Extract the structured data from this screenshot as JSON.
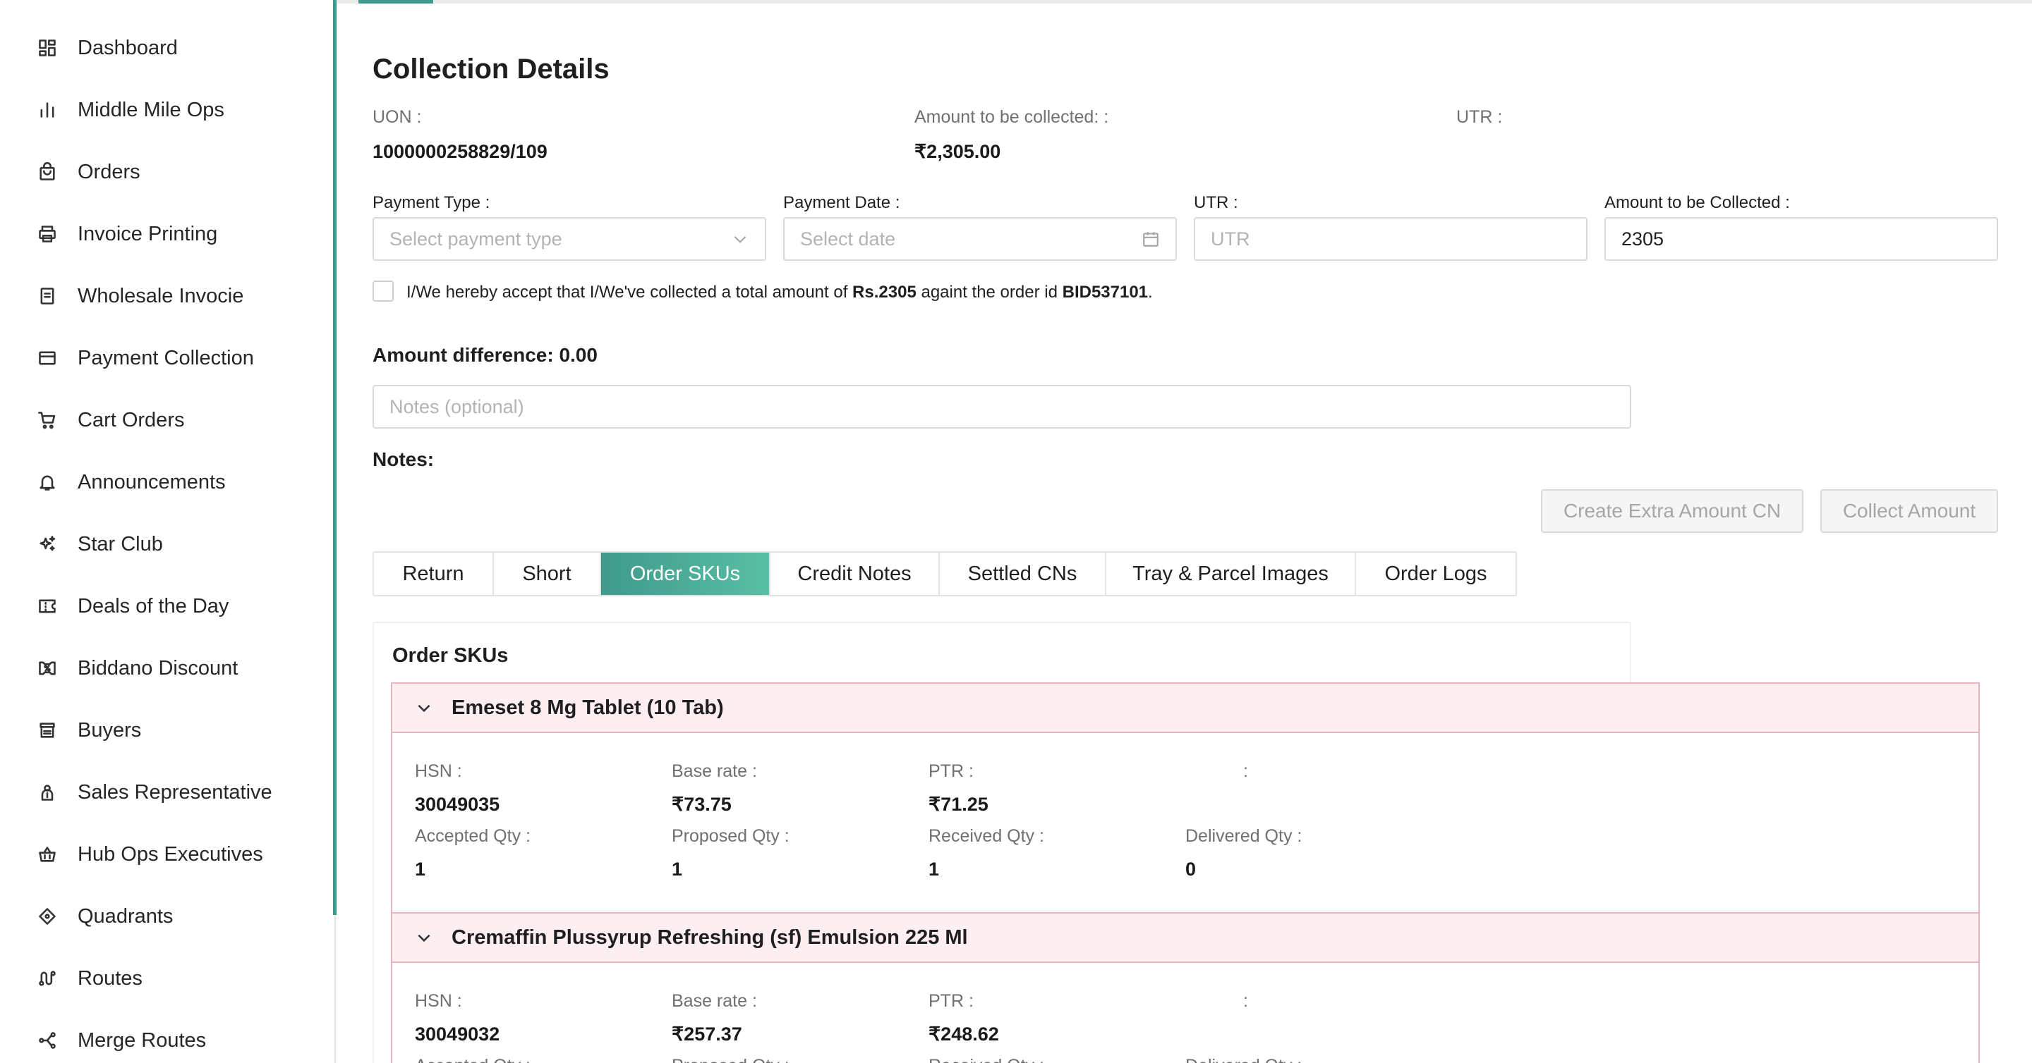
{
  "sidebar": {
    "items": [
      {
        "label": "Dashboard",
        "icon": "dashboard-icon"
      },
      {
        "label": "Middle Mile Ops",
        "icon": "bar-chart-icon"
      },
      {
        "label": "Orders",
        "icon": "shopping-bag-icon"
      },
      {
        "label": "Invoice Printing",
        "icon": "printer-icon"
      },
      {
        "label": "Wholesale Invocie",
        "icon": "document-icon"
      },
      {
        "label": "Payment Collection",
        "icon": "credit-card-icon"
      },
      {
        "label": "Cart Orders",
        "icon": "cart-icon"
      },
      {
        "label": "Announcements",
        "icon": "bell-icon"
      },
      {
        "label": "Star Club",
        "icon": "sparkle-icon"
      },
      {
        "label": "Deals of the Day",
        "icon": "coupon-icon"
      },
      {
        "label": "Biddano Discount",
        "icon": "discount-tag-icon"
      },
      {
        "label": "Buyers",
        "icon": "store-icon"
      },
      {
        "label": "Sales Representative",
        "icon": "user-badge-icon"
      },
      {
        "label": "Hub Ops Executives",
        "icon": "basket-icon"
      },
      {
        "label": "Quadrants",
        "icon": "diamond-icon"
      },
      {
        "label": "Routes",
        "icon": "route-icon"
      },
      {
        "label": "Merge Routes",
        "icon": "merge-icon"
      }
    ],
    "accent_color": "#3f9a8c"
  },
  "collection": {
    "title": "Collection Details",
    "uon_label": "UON :",
    "uon_value": "1000000258829/109",
    "amount_label": "Amount to be collected: :",
    "amount_value": "₹2,305.00",
    "utr_label": "UTR :",
    "utr_value": ""
  },
  "form": {
    "payment_type_label": "Payment Type :",
    "payment_type_placeholder": "Select payment type",
    "payment_date_label": "Payment Date :",
    "payment_date_placeholder": "Select date",
    "utr_label": "UTR :",
    "utr_placeholder": "UTR",
    "amount_label": "Amount to be Collected :",
    "amount_value": "2305",
    "consent_prefix": "I/We hereby accept that I/We've collected a total amount of ",
    "consent_amount": "Rs.2305",
    "consent_middle": " againt the order id ",
    "consent_order": "BID537101",
    "consent_suffix": ".",
    "consent_checked": false,
    "amount_difference": "Amount difference: 0.00",
    "notes_placeholder": "Notes (optional)",
    "notes_title": "Notes:"
  },
  "actions": {
    "create_cn": "Create Extra Amount CN",
    "collect": "Collect Amount"
  },
  "tabs": [
    {
      "label": "Return",
      "active": false
    },
    {
      "label": "Short",
      "active": false
    },
    {
      "label": "Order SKUs",
      "active": true
    },
    {
      "label": "Credit Notes",
      "active": false
    },
    {
      "label": "Settled CNs",
      "active": false
    },
    {
      "label": "Tray & Parcel Images",
      "active": false
    },
    {
      "label": "Order Logs",
      "active": false
    }
  ],
  "order_skus": {
    "title": "Order SKUs",
    "items": [
      {
        "name": "Emeset 8 Mg Tablet (10 Tab)",
        "hsn_label": "HSN :",
        "hsn": "30049035",
        "base_rate_label": "Base rate :",
        "base_rate": "₹73.75",
        "ptr_label": "PTR :",
        "ptr": "₹71.25",
        "blank_label": ":",
        "accepted_label": "Accepted Qty :",
        "accepted": "1",
        "proposed_label": "Proposed Qty :",
        "proposed": "1",
        "received_label": "Received Qty :",
        "received": "1",
        "delivered_label": "Delivered Qty :",
        "delivered": "0"
      },
      {
        "name": "Cremaffin Plussyrup Refreshing (sf) Emulsion 225 Ml",
        "hsn_label": "HSN :",
        "hsn": "30049032",
        "base_rate_label": "Base rate :",
        "base_rate": "₹257.37",
        "ptr_label": "PTR :",
        "ptr": "₹248.62",
        "blank_label": ":",
        "accepted_label": "Accepted Qty :",
        "proposed_label": "Proposed Qty :",
        "received_label": "Received Qty :",
        "delivered_label": "Delivered Qty :"
      }
    ]
  }
}
